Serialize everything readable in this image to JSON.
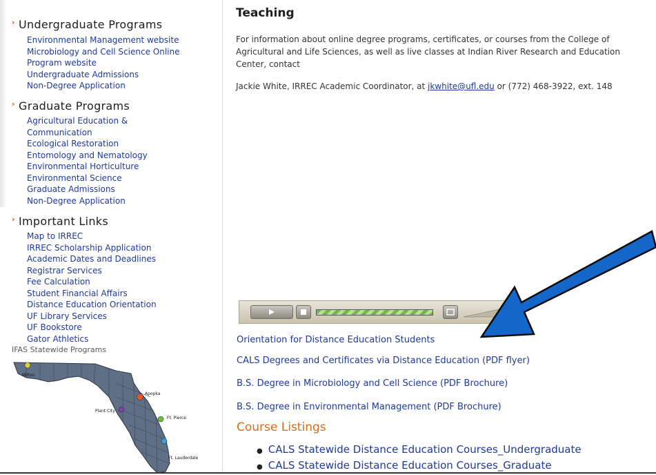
{
  "sidebar": {
    "undergrad": {
      "heading": "Undergraduate Programs",
      "links": [
        "Environmental Management website",
        "Microbiology and Cell Science Online",
        "Program website",
        "Undergraduate Admissions",
        "Non-Degree Application"
      ]
    },
    "grad": {
      "heading": "Graduate Programs",
      "links": [
        "Agricultural Education &",
        "Communication",
        "Ecological Restoration",
        "Entomology and Nematology",
        "Environmental Horticulture",
        "Environmental Science",
        "Graduate Admissions",
        "Non-Degree Application"
      ]
    },
    "important": {
      "heading": "Important Links",
      "links": [
        "Map to IRREC",
        "IRREC Scholarship Application",
        "Academic Dates and Deadlines",
        "Registrar Services",
        "Fee Calculation",
        "Student Financial Affairs",
        "Distance Education Orientation",
        "UF Library Services",
        "UF Bookstore",
        "Gator Athletics"
      ]
    },
    "map_label": "IFAS Statewide Programs",
    "map_places": [
      "Milton",
      "Apopka",
      "Plant City",
      "Ft. Pierce",
      "Ft. Lauderdale"
    ]
  },
  "main": {
    "title": "Teaching",
    "intro": "For information about online degree programs, certificates, or courses from the College of Agricultural and Life Sciences, as well as live classes at Indian River Research and Education Center, contact",
    "contact_prefix": "Jackie White, IRREC Academic Coordinator, at ",
    "contact_email": "jkwhite@ufl.edu",
    "contact_suffix": " or (772) 468-3922, ext. 148",
    "links": [
      "Orientation for Distance Education Students",
      "CALS Degrees and Certificates via Distance Education (PDF flyer)",
      "B.S. Degree in Microbiology and Cell Science (PDF Brochure)",
      "B.S. Degree in Environmental Management (PDF Brochure)"
    ],
    "course_heading": "Course Listings",
    "courses": [
      "CALS Statewide Distance Education Courses_Undergraduate",
      "CALS Statewide Distance Education Courses_Graduate"
    ]
  },
  "player": {
    "play_icon": "play-icon",
    "stop_icon": "stop-icon",
    "progress": 1.0
  },
  "colors": {
    "link": "#1e3a9c",
    "heading_orange": "#e06a10",
    "arrow": "#1466c8"
  }
}
